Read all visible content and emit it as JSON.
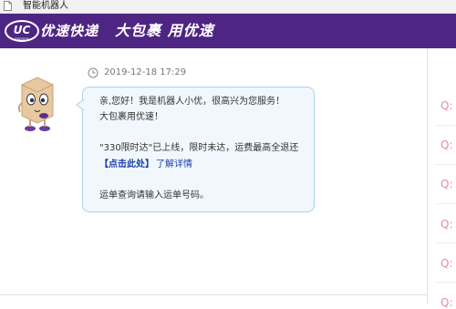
{
  "window": {
    "title": "智能机器人"
  },
  "header": {
    "brand": "优速快递",
    "slogan": "大包裹 用优速",
    "logo_text": "UC",
    "logo_subtext": "express",
    "background": "#4f2583"
  },
  "chat": {
    "timestamp": "2019-12-18 17:29",
    "message": {
      "line1": "亲,您好！我是机器人小优，很高兴为您服务！",
      "line2": "大包裹用优速！",
      "line3": "\"330限时达\"已上线，限时未达，运费最高全退还",
      "link_label": "【点击此处】",
      "link_more": "了解详情",
      "line5": "运单查询请输入运单号码。"
    }
  },
  "side_panel": {
    "items": [
      "Q:",
      "Q:",
      "Q:",
      "Q:",
      "Q:",
      "Q:"
    ]
  },
  "colors": {
    "bubble_bg": "#f1f7fd",
    "bubble_border": "#aad2ec",
    "link": "#1a3fa8",
    "question_mark": "#e88a9a"
  }
}
